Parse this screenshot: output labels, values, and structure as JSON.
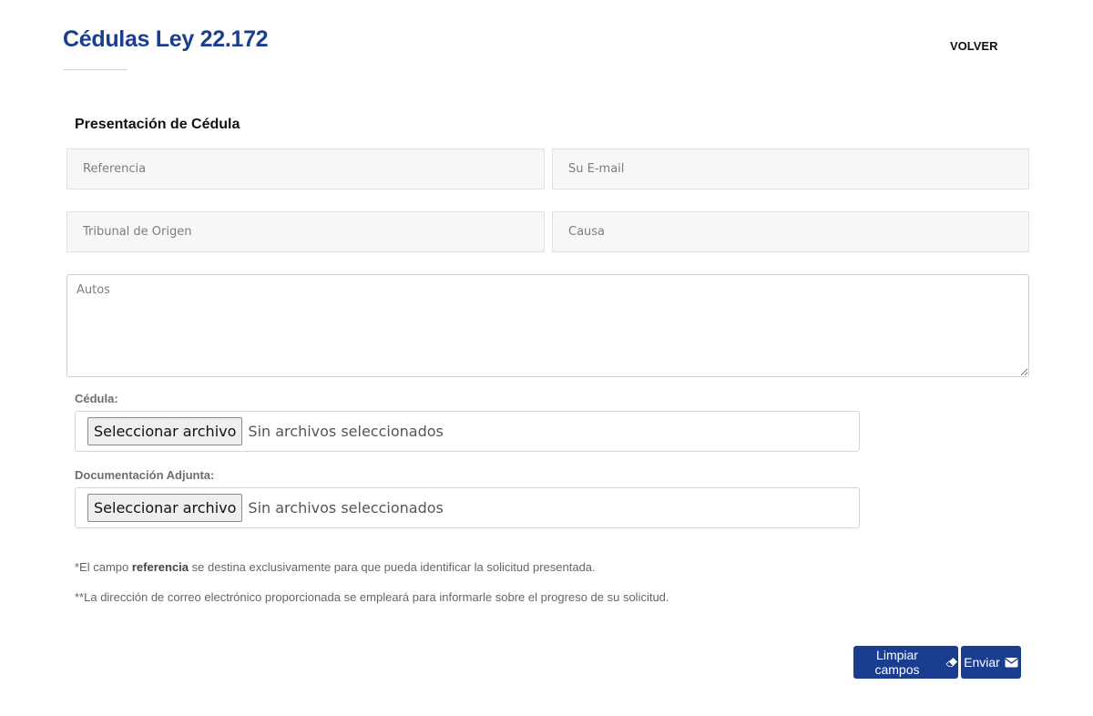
{
  "header": {
    "title": "Cédulas Ley 22.172",
    "back_label": "VOLVER"
  },
  "form": {
    "section_title": "Presentación de Cédula",
    "fields": {
      "referencia": {
        "placeholder": "Referencia",
        "value": ""
      },
      "email": {
        "placeholder": "Su E-mail",
        "value": ""
      },
      "tribunal": {
        "placeholder": "Tribunal de Origen",
        "value": ""
      },
      "causa": {
        "placeholder": "Causa",
        "value": ""
      },
      "autos": {
        "placeholder": "Autos",
        "value": ""
      }
    },
    "file_cedula": {
      "label": "Cédula:",
      "button_label": "Seleccionar archivo",
      "status": "Sin archivos seleccionados"
    },
    "file_docs": {
      "label": "Documentación Adjunta:",
      "button_label": "Seleccionar archivo",
      "status": "Sin archivos seleccionados"
    },
    "notes": {
      "note1_prefix": "*El campo ",
      "note1_bold": "referencia",
      "note1_suffix": " se destina exclusivamente para que pueda identificar la solicitud presentada.",
      "note2": "**La dirección de correo electrónico proporcionada se empleará para informarle sobre el progreso de su solicitud."
    },
    "actions": {
      "clear_label": "Limpiar campos",
      "clear_icon": "eraser-icon",
      "send_label": "Enviar",
      "send_icon": "envelope-icon"
    }
  },
  "colors": {
    "brand": "#1b3d8f",
    "field_bg": "#f7f7f7"
  }
}
